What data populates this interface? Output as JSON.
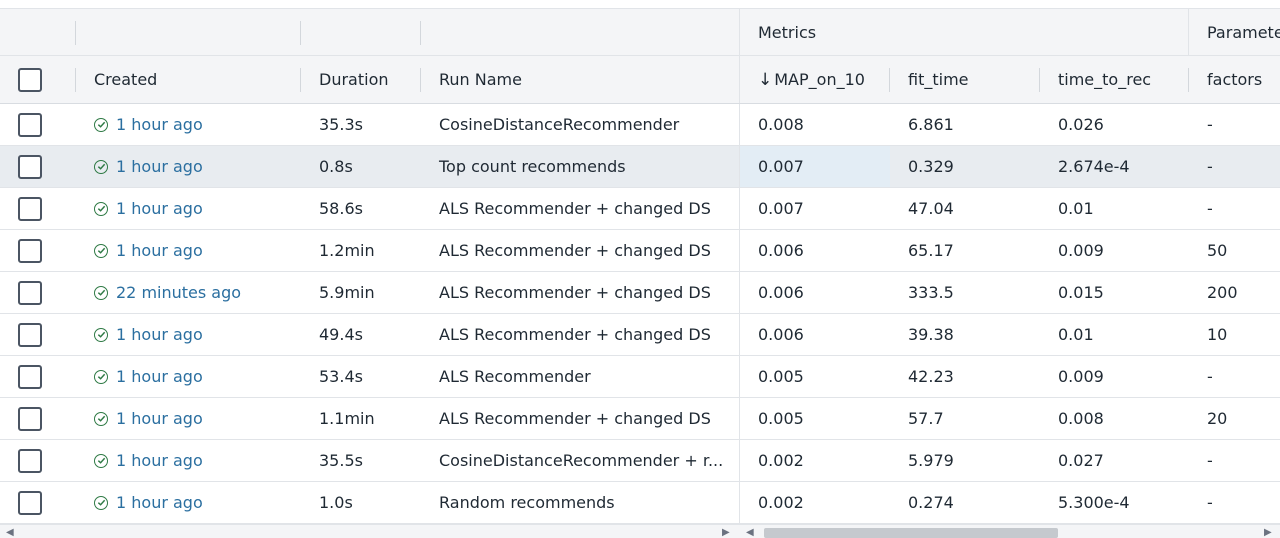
{
  "group_headers": {
    "metrics": "Metrics",
    "parameters": "Parameters"
  },
  "columns": {
    "created": "Created",
    "duration": "Duration",
    "run_name": "Run Name",
    "map_on_10": "MAP_on_10",
    "fit_time": "fit_time",
    "time_to_rec": "time_to_rec",
    "factors": "factors"
  },
  "sort": {
    "column": "MAP_on_10",
    "direction": "descending"
  },
  "rows": [
    {
      "created": "1 hour ago",
      "duration": "35.3s",
      "run_name": "CosineDistanceRecommender",
      "map_on_10": "0.008",
      "fit_time": "6.861",
      "time_to_rec": "0.026",
      "factors": "-"
    },
    {
      "created": "1 hour ago",
      "duration": "0.8s",
      "run_name": "Top count recommends",
      "map_on_10": "0.007",
      "fit_time": "0.329",
      "time_to_rec": "2.674e-4",
      "factors": "-"
    },
    {
      "created": "1 hour ago",
      "duration": "58.6s",
      "run_name": "ALS Recommender + changed DS",
      "map_on_10": "0.007",
      "fit_time": "47.04",
      "time_to_rec": "0.01",
      "factors": "-"
    },
    {
      "created": "1 hour ago",
      "duration": "1.2min",
      "run_name": "ALS Recommender + changed DS",
      "map_on_10": "0.006",
      "fit_time": "65.17",
      "time_to_rec": "0.009",
      "factors": "50"
    },
    {
      "created": "22 minutes ago",
      "duration": "5.9min",
      "run_name": "ALS Recommender + changed DS",
      "map_on_10": "0.006",
      "fit_time": "333.5",
      "time_to_rec": "0.015",
      "factors": "200"
    },
    {
      "created": "1 hour ago",
      "duration": "49.4s",
      "run_name": "ALS Recommender + changed DS",
      "map_on_10": "0.006",
      "fit_time": "39.38",
      "time_to_rec": "0.01",
      "factors": "10"
    },
    {
      "created": "1 hour ago",
      "duration": "53.4s",
      "run_name": "ALS Recommender",
      "map_on_10": "0.005",
      "fit_time": "42.23",
      "time_to_rec": "0.009",
      "factors": "-"
    },
    {
      "created": "1 hour ago",
      "duration": "1.1min",
      "run_name": "ALS Recommender + changed DS",
      "map_on_10": "0.005",
      "fit_time": "57.7",
      "time_to_rec": "0.008",
      "factors": "20"
    },
    {
      "created": "1 hour ago",
      "duration": "35.5s",
      "run_name": "CosineDistanceRecommender + r...",
      "map_on_10": "0.002",
      "fit_time": "5.979",
      "time_to_rec": "0.027",
      "factors": "-"
    },
    {
      "created": "1 hour ago",
      "duration": "1.0s",
      "run_name": "Random recommends",
      "map_on_10": "0.002",
      "fit_time": "0.274",
      "time_to_rec": "5.300e-4",
      "factors": "-"
    }
  ],
  "icons": {
    "status": "check-circle-icon",
    "sort": "arrow-down-icon"
  },
  "colors": {
    "link": "#2b6fa0",
    "success": "#2f7a45",
    "sorted_column_bg": "#eff6fc",
    "hover_row_bg": "#e8ecf0"
  }
}
